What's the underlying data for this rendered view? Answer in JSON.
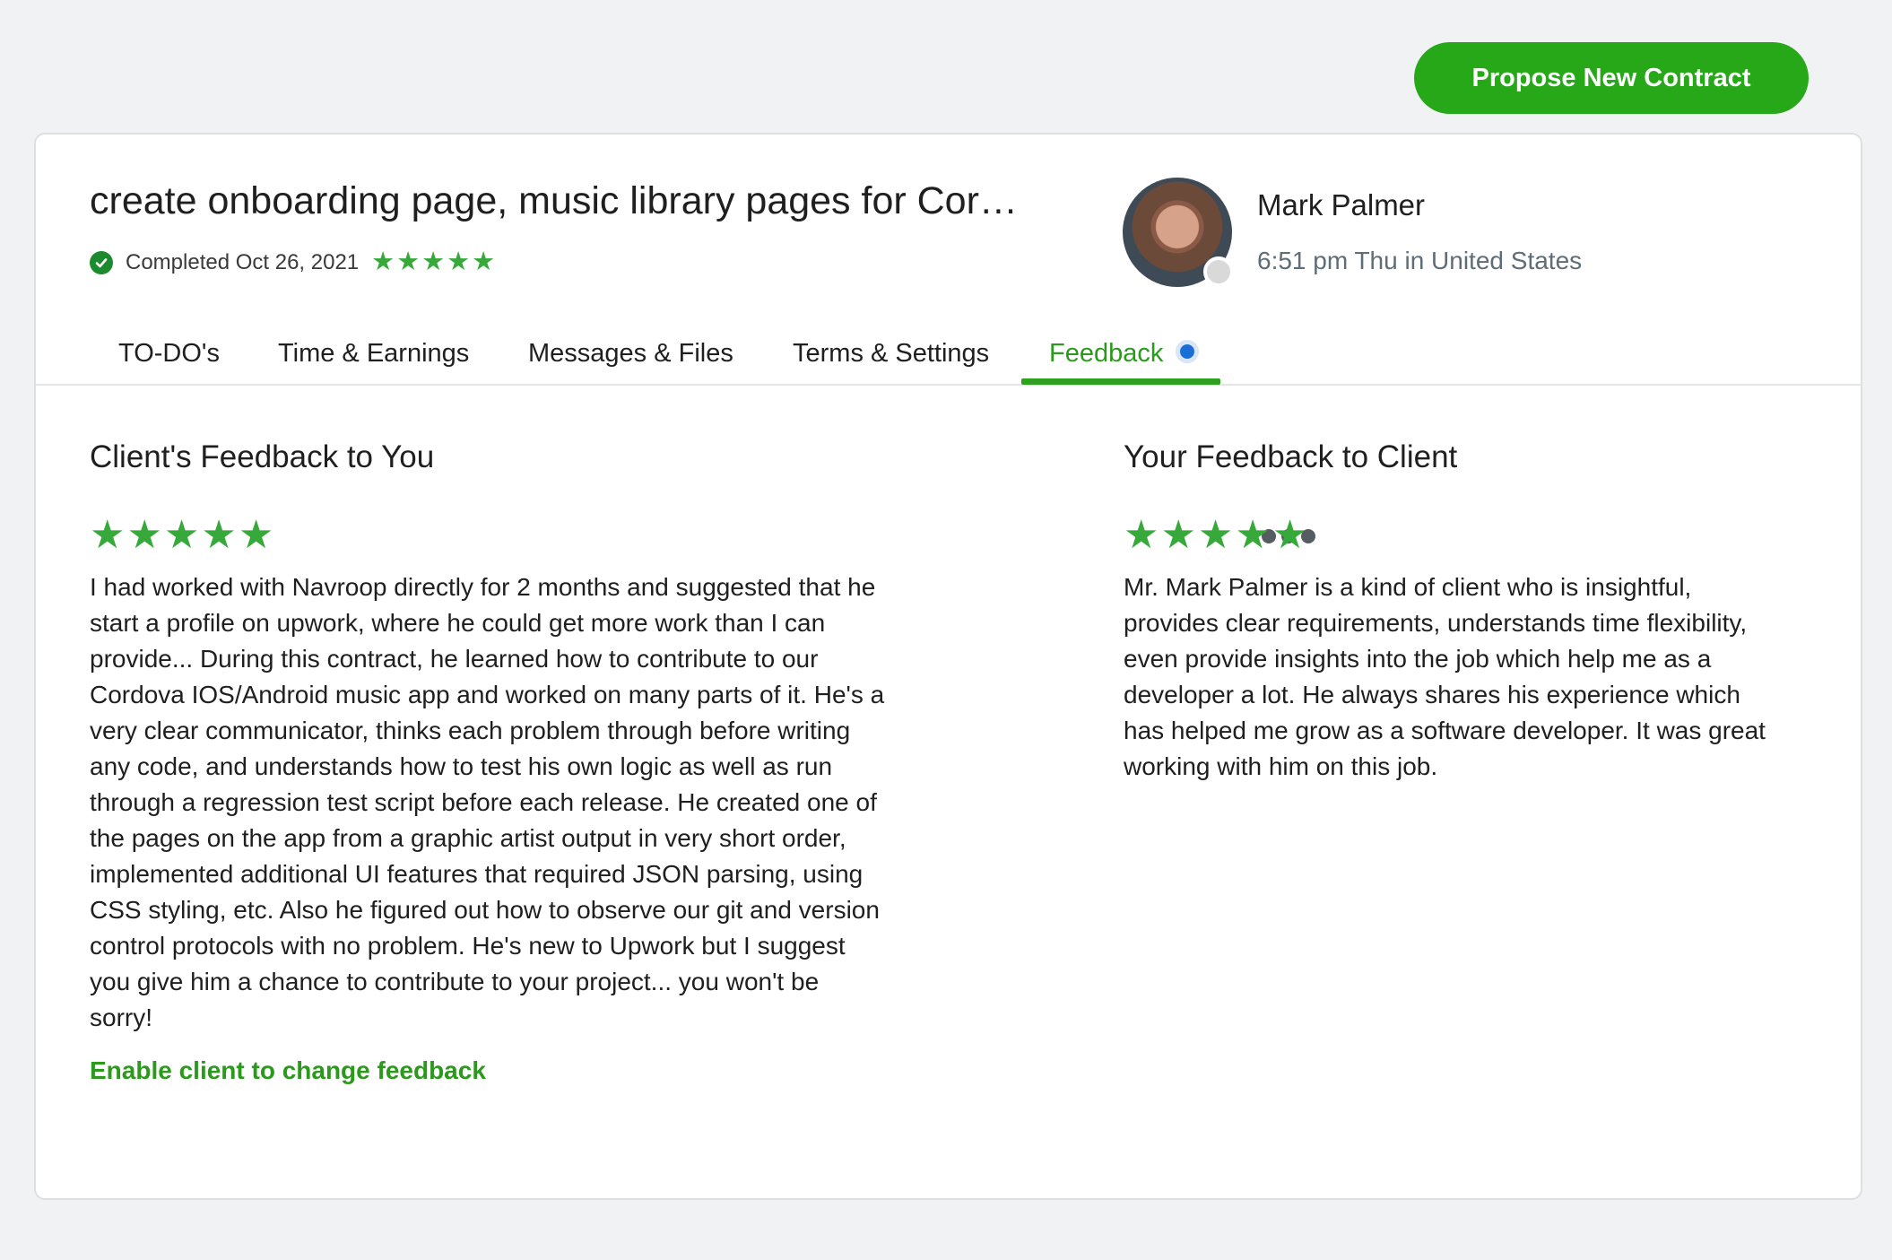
{
  "header": {
    "propose_button": "Propose New Contract"
  },
  "job": {
    "title": "create onboarding page, music library pages for Cor…",
    "status": "Completed Oct 26, 2021",
    "rating": 5
  },
  "client": {
    "name": "Mark Palmer",
    "local_time": "6:51 pm Thu in United States"
  },
  "tabs": [
    {
      "label": "TO-DO's"
    },
    {
      "label": "Time & Earnings"
    },
    {
      "label": "Messages & Files"
    },
    {
      "label": "Terms & Settings"
    },
    {
      "label": "Feedback",
      "active": true
    }
  ],
  "client_feedback": {
    "heading": "Client's Feedback to You",
    "rating": 5,
    "lines": [
      "I had worked with Navroop directly for 2 months and suggested that he",
      "start a profile on upwork, where he could get more work than I can",
      "provide... During this contract, he learned how to contribute to our",
      "Cordova IOS/Android music app and worked on many parts of it. He's a",
      "very clear communicator, thinks each problem through before writing",
      "any code, and understands how to test his own logic as well as run",
      "through a regression test script before each release. He created one of",
      "the pages on the app from a graphic artist output in very short order,",
      "implemented additional UI features that required JSON parsing, using",
      "CSS styling, etc. Also he figured out how to observe our git and version",
      "control protocols with no problem. He's new to Upwork but I suggest",
      "you give him a chance to contribute to your project... you won't be",
      "sorry!"
    ],
    "enable_link": "Enable client to change feedback"
  },
  "your_feedback": {
    "heading": "Your Feedback to Client",
    "rating": 5,
    "lines": [
      "Mr. Mark Palmer is a kind of client who is insightful,",
      "provides clear requirements, understands time flexibility,",
      "even provide insights into the job which help me as a",
      "developer a lot. He always shares his experience which",
      "has helped me grow as a software developer. It was great",
      "working with him on this job."
    ]
  },
  "colors": {
    "brand_green": "#26a818",
    "star_green": "#37a93a",
    "notification_blue": "#1a6fd6"
  },
  "icons": {
    "status": "check-circle-icon",
    "more": "more-horizontal-icon",
    "star": "star-icon"
  }
}
